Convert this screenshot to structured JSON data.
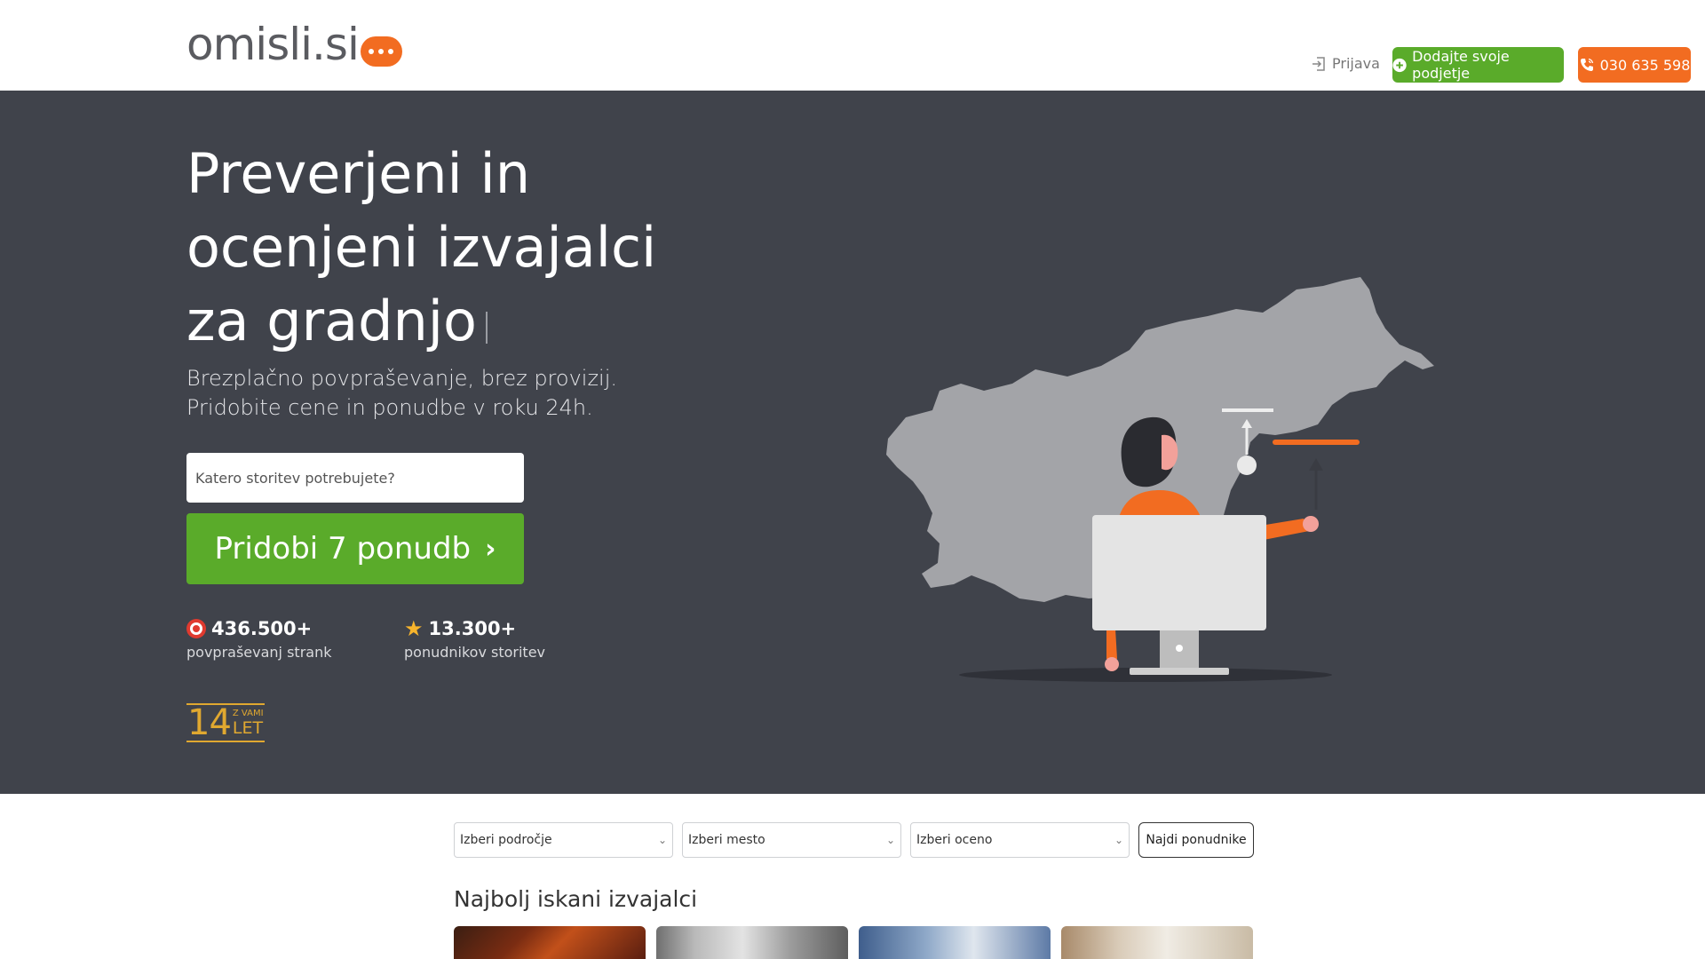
{
  "header": {
    "logo_text": "omisli.si",
    "login_label": "Prijava",
    "add_company_label": "Dodajte svoje podjetje",
    "phone_label": "030 635 598"
  },
  "hero": {
    "title": "Preverjeni in ocenjeni izvajalci za gradnjo",
    "subtitle_line1": "Brezplačno povpraševanje, brez provizij.",
    "subtitle_line2": "Pridobite cene in ponudbe v roku 24h.",
    "search_placeholder": "Katero storitev potrebujete?",
    "cta_label": "Pridobi 7 ponudb",
    "stats": [
      {
        "value": "436.500+",
        "label": "povpraševanj strank",
        "icon": "target-icon"
      },
      {
        "value": "13.300+",
        "label": "ponudnikov storitev",
        "icon": "star-icon"
      }
    ],
    "badge": {
      "number": "14",
      "small": "Z VAMI",
      "big": "LET"
    }
  },
  "filters": {
    "area_label": "Izberi področje",
    "city_label": "Izberi mesto",
    "rating_label": "Izberi oceno",
    "find_label": "Najdi ponudnike"
  },
  "section": {
    "title": "Najbolj iskani izvajalci"
  },
  "colors": {
    "hero_bg": "#40434b",
    "green": "#5aab2a",
    "orange": "#f26c21",
    "gold": "#e0a830"
  }
}
